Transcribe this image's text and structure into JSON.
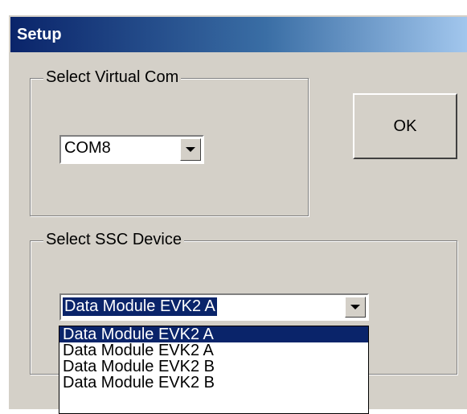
{
  "dialog": {
    "title": "Setup"
  },
  "com_group": {
    "legend": "Select Virtual Com",
    "combo_value": "COM8"
  },
  "ok_button": {
    "label": "OK"
  },
  "device_group": {
    "legend": "Select SSC Device",
    "combo_value": "Data Module EVK2 A",
    "dropdown_options": [
      "Data Module EVK2 A",
      "Data Module EVK2 A",
      "Data Module EVK2 B",
      "Data Module EVK2 B"
    ],
    "highlighted_index": 0
  },
  "colors": {
    "face": "#d4d0c8",
    "title_start": "#0a246a",
    "title_end": "#a6caf0",
    "selection": "#0a246a"
  }
}
